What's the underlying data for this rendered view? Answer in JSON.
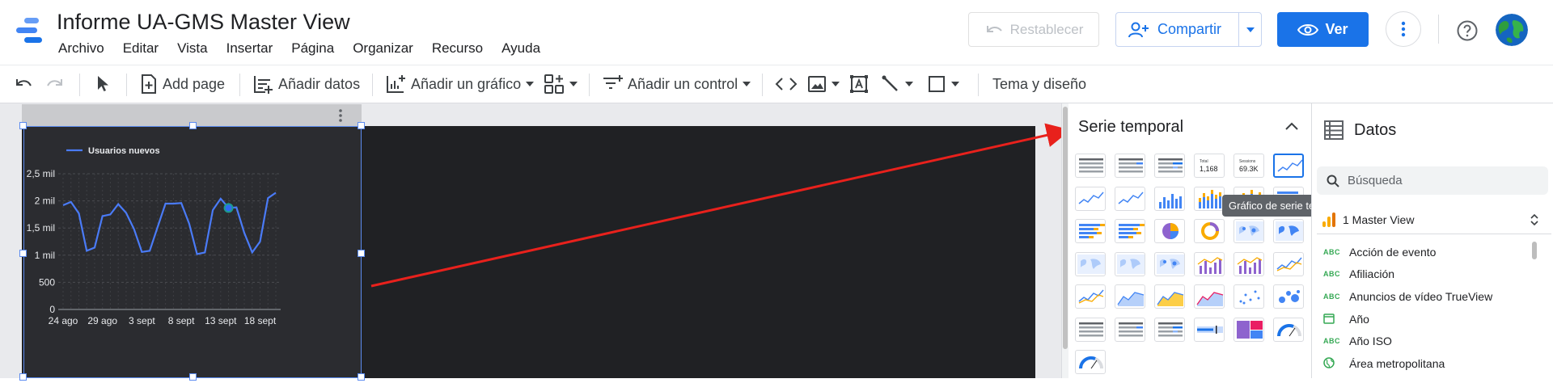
{
  "header": {
    "title": "Informe UA-GMS Master View",
    "menu": [
      "Archivo",
      "Editar",
      "Vista",
      "Insertar",
      "Página",
      "Organizar",
      "Recurso",
      "Ayuda"
    ],
    "reset_label": "Restablecer",
    "share_label": "Compartir",
    "view_label": "Ver"
  },
  "toolbar": {
    "add_page": "Add page",
    "add_data": "Añadir datos",
    "add_chart": "Añadir un gráfico",
    "add_control": "Añadir un control",
    "theme": "Tema y diseño"
  },
  "chart_data": {
    "type": "line",
    "legend": "Usuarios nuevos",
    "legend_position": "top-left",
    "x_ticks": [
      "24 ago",
      "29 ago",
      "3 sept",
      "8 sept",
      "13 sept",
      "18 sept"
    ],
    "y_ticks": [
      "0",
      "500",
      "1 mil",
      "1,5 mil",
      "2 mil",
      "2,5 mil"
    ],
    "ylim": [
      0,
      2500
    ],
    "values": [
      1920,
      1980,
      1770,
      1080,
      1140,
      1720,
      1750,
      1940,
      1780,
      1480,
      1060,
      1080,
      1520,
      1950,
      1950,
      1960,
      1580,
      1020,
      1050,
      1830,
      2040,
      1870,
      1880,
      1410,
      1050,
      1250,
      2050,
      2150
    ],
    "series_color": "#4a7bf7",
    "grid": true
  },
  "props": {
    "title": "Serie temporal",
    "tooltip": "Gráfico de serie temporal",
    "scorecard1_label": "Total",
    "scorecard1_value": "1,168",
    "scorecard2_label": "Sessions",
    "scorecard2_value": "69.3K"
  },
  "data": {
    "title": "Datos",
    "search_placeholder": "Búsqueda",
    "source": "1 Master View",
    "fields": [
      {
        "type": "ABC",
        "name": "Acción de evento"
      },
      {
        "type": "ABC",
        "name": "Afiliación"
      },
      {
        "type": "ABC",
        "name": "Anuncios de vídeo TrueView"
      },
      {
        "type": "cal",
        "name": "Año"
      },
      {
        "type": "ABC",
        "name": "Año ISO"
      },
      {
        "type": "geo",
        "name": "Área metropolitana"
      }
    ]
  },
  "colors": {
    "accent": "#1a73e8",
    "arrow": "#e8211c",
    "selection": "#5b8bf0"
  }
}
